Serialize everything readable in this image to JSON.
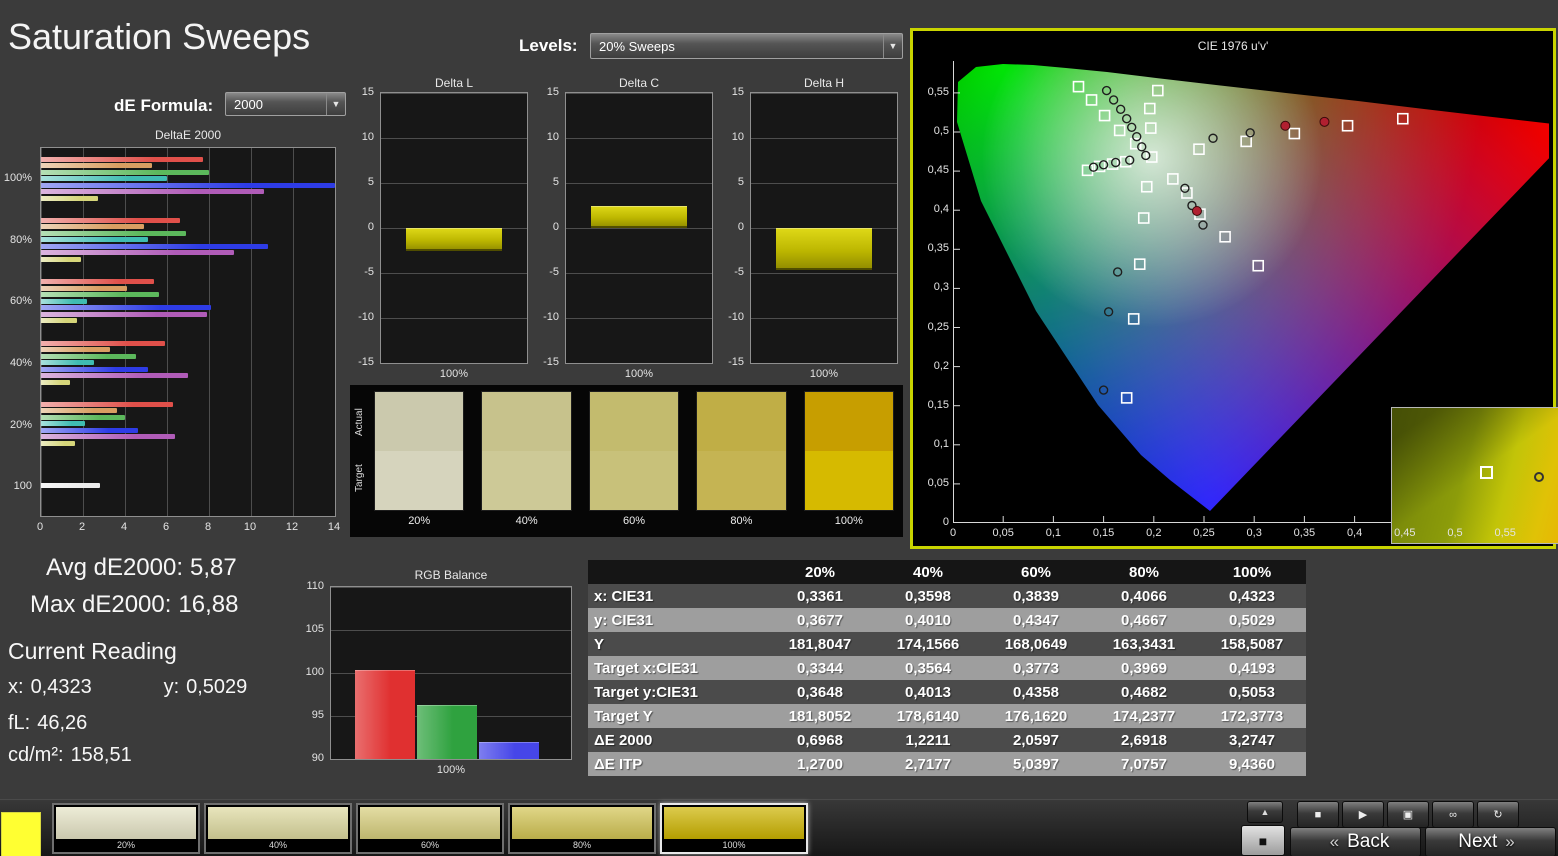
{
  "window": {
    "title": "Saturation Sweeps",
    "background": "#3b3b3b",
    "accent_border": "#c9d400"
  },
  "controls": {
    "levels": {
      "label": "Levels:",
      "value": "20% Sweeps"
    },
    "de_formula": {
      "label": "dE Formula:",
      "value": "2000"
    }
  },
  "summary": {
    "avg": {
      "label": "Avg dE2000:",
      "value": "5,87"
    },
    "max": {
      "label": "Max dE2000:",
      "value": "16,88"
    },
    "current_reading": "Current Reading",
    "x": {
      "label": "x:",
      "value": "0,4323"
    },
    "y": {
      "label": "y:",
      "value": "0,5029"
    },
    "fl": {
      "label": "fL:",
      "value": "46,26"
    },
    "cdm2": {
      "label": "cd/m²:",
      "value": "158,51"
    }
  },
  "chart_data": {
    "deltae2000": {
      "type": "bar",
      "title": "DeltaE 2000",
      "orientation": "horizontal",
      "xlim": [
        0,
        14
      ],
      "xticks": [
        0,
        2,
        4,
        6,
        8,
        10,
        12,
        14
      ],
      "groups": [
        "100%",
        "80%",
        "60%",
        "40%",
        "20%",
        "100"
      ],
      "series_colors": [
        "#e0504a",
        "#d99e62",
        "#5cb85c",
        "#3fbcb2",
        "#2e3ce6",
        "#b05cb8",
        "#d6d67a"
      ],
      "single_color": "#ececec",
      "values": [
        [
          7.7,
          5.3,
          8.0,
          6.0,
          14.3,
          10.6,
          2.7
        ],
        [
          6.6,
          4.9,
          6.9,
          5.1,
          10.8,
          9.2,
          1.9
        ],
        [
          5.4,
          4.1,
          5.6,
          2.2,
          8.1,
          7.9,
          1.7
        ],
        [
          5.9,
          3.3,
          4.5,
          2.5,
          5.1,
          7.0,
          1.4
        ],
        [
          6.3,
          3.6,
          4.0,
          2.1,
          4.6,
          6.4,
          1.6
        ],
        [
          2.8
        ]
      ]
    },
    "delta_l": {
      "type": "bar",
      "title": "Delta L",
      "ylim": [
        -15,
        15
      ],
      "yticks": [
        15,
        10,
        5,
        0,
        -5,
        -10,
        -15
      ],
      "xlabel": "100%",
      "values": [
        -2.5
      ],
      "bar_color": "#bcb600"
    },
    "delta_c": {
      "type": "bar",
      "title": "Delta C",
      "ylim": [
        -15,
        15
      ],
      "yticks": [
        15,
        10,
        5,
        0,
        -5,
        -10,
        -15
      ],
      "xlabel": "100%",
      "values": [
        2.4
      ],
      "bar_color": "#bcb600"
    },
    "delta_h": {
      "type": "bar",
      "title": "Delta H",
      "ylim": [
        -15,
        15
      ],
      "yticks": [
        15,
        10,
        5,
        0,
        -5,
        -10,
        -15
      ],
      "xlabel": "100%",
      "values": [
        -4.7
      ],
      "bar_color": "#bcb600"
    },
    "rgb_balance": {
      "type": "bar",
      "title": "RGB Balance",
      "ylim": [
        90,
        110
      ],
      "yticks": [
        110,
        105,
        100,
        95,
        90
      ],
      "xlabel": "100%",
      "series": [
        {
          "name": "Red",
          "value": 100.3,
          "color": "#e03030"
        },
        {
          "name": "Green",
          "value": 96.3,
          "color": "#2fa23f"
        },
        {
          "name": "Blue",
          "value": 92.0,
          "color": "#4646e8"
        }
      ]
    },
    "cie": {
      "type": "scatter",
      "title": "CIE 1976 u'v'",
      "xlim": [
        0,
        0.5936
      ],
      "ylim": [
        0,
        0.5908
      ],
      "xtick_labels": [
        "0",
        "0,05",
        "0,1",
        "0,15",
        "0,2",
        "0,25",
        "0,3",
        "0,35",
        "0,4",
        "0,45",
        "0,5",
        "0,55"
      ],
      "ytick_labels": [
        "0,55",
        "0,5",
        "0,45",
        "0,4",
        "0,35",
        "0,3",
        "0,25",
        "0,2",
        "0,15",
        "0,1",
        "0,05",
        "0"
      ],
      "targets": [
        [
          0.198,
          0.468
        ],
        [
          0.245,
          0.478
        ],
        [
          0.292,
          0.488
        ],
        [
          0.34,
          0.498
        ],
        [
          0.393,
          0.508
        ],
        [
          0.448,
          0.517
        ],
        [
          0.182,
          0.485
        ],
        [
          0.166,
          0.502
        ],
        [
          0.151,
          0.521
        ],
        [
          0.138,
          0.541
        ],
        [
          0.125,
          0.558
        ],
        [
          0.193,
          0.43
        ],
        [
          0.19,
          0.39
        ],
        [
          0.186,
          0.331
        ],
        [
          0.18,
          0.261
        ],
        [
          0.173,
          0.16
        ],
        [
          0.172,
          0.462
        ],
        [
          0.159,
          0.459
        ],
        [
          0.146,
          0.456
        ],
        [
          0.134,
          0.451
        ],
        [
          0.219,
          0.44
        ],
        [
          0.233,
          0.422
        ],
        [
          0.246,
          0.395
        ],
        [
          0.271,
          0.366
        ],
        [
          0.304,
          0.329
        ],
        [
          0.197,
          0.505
        ],
        [
          0.196,
          0.53
        ],
        [
          0.204,
          0.553
        ]
      ],
      "measurements": [
        [
          0.153,
          0.553
        ],
        [
          0.16,
          0.541
        ],
        [
          0.167,
          0.529
        ],
        [
          0.173,
          0.517
        ],
        [
          0.178,
          0.506
        ],
        [
          0.183,
          0.494
        ],
        [
          0.188,
          0.481
        ],
        [
          0.192,
          0.47
        ],
        [
          0.259,
          0.492
        ],
        [
          0.296,
          0.499
        ],
        [
          0.231,
          0.428
        ],
        [
          0.238,
          0.406
        ],
        [
          0.249,
          0.381
        ],
        [
          0.164,
          0.321
        ],
        [
          0.155,
          0.27
        ],
        [
          0.15,
          0.17
        ],
        [
          0.14,
          0.455
        ],
        [
          0.15,
          0.458
        ],
        [
          0.162,
          0.461
        ],
        [
          0.176,
          0.464
        ]
      ],
      "measurements_flagged": [
        [
          0.331,
          0.508
        ],
        [
          0.37,
          0.513
        ],
        [
          0.243,
          0.399
        ]
      ],
      "flag_color": "#b02030"
    },
    "table": {
      "type": "table",
      "columns": [
        "",
        "20%",
        "40%",
        "60%",
        "80%",
        "100%"
      ],
      "rows": [
        {
          "label": "x: CIE31",
          "cells": [
            "0,3361",
            "0,3598",
            "0,3839",
            "0,4066",
            "0,4323"
          ]
        },
        {
          "label": "y: CIE31",
          "cells": [
            "0,3677",
            "0,4010",
            "0,4347",
            "0,4667",
            "0,5029"
          ]
        },
        {
          "label": "Y",
          "cells": [
            "181,8047",
            "174,1566",
            "168,0649",
            "163,3431",
            "158,5087"
          ]
        },
        {
          "label": "Target x:CIE31",
          "cells": [
            "0,3344",
            "0,3564",
            "0,3773",
            "0,3969",
            "0,4193"
          ]
        },
        {
          "label": "Target y:CIE31",
          "cells": [
            "0,3648",
            "0,4013",
            "0,4358",
            "0,4682",
            "0,5053"
          ]
        },
        {
          "label": "Target Y",
          "cells": [
            "181,8052",
            "178,6140",
            "176,1620",
            "174,2377",
            "172,3773"
          ]
        },
        {
          "label": "ΔE 2000",
          "cells": [
            "0,6968",
            "1,2211",
            "2,0597",
            "2,6918",
            "3,2747"
          ]
        },
        {
          "label": "ΔE ITP",
          "cells": [
            "1,2700",
            "2,7177",
            "5,0397",
            "7,0757",
            "9,4360"
          ]
        }
      ]
    }
  },
  "strip": {
    "actual_label": "Actual",
    "target_label": "Target",
    "items": [
      {
        "label": "20%",
        "actual": "#cbc9ad",
        "target": "#d6d4bd"
      },
      {
        "label": "40%",
        "actual": "#c7c28c",
        "target": "#cdc997"
      },
      {
        "label": "60%",
        "actual": "#c3bb6e",
        "target": "#c8c17a"
      },
      {
        "label": "80%",
        "actual": "#c0ae46",
        "target": "#c5b453"
      },
      {
        "label": "100%",
        "actual": "#c79e00",
        "target": "#d6ba00"
      }
    ]
  },
  "bottom_bar": {
    "current_patch_color": "#ffff32",
    "swatches": [
      {
        "label": "20%",
        "color": "#e6e4c6",
        "selected": false
      },
      {
        "label": "40%",
        "color": "#dedaa0",
        "selected": false
      },
      {
        "label": "60%",
        "color": "#d8cf7d",
        "selected": false
      },
      {
        "label": "80%",
        "color": "#d3c554",
        "selected": false
      },
      {
        "label": "100%",
        "color": "#cdb400",
        "selected": true
      }
    ],
    "up_button_icon": "▲",
    "transport": [
      {
        "name": "stop",
        "icon": "■"
      },
      {
        "name": "play",
        "icon": "▶"
      },
      {
        "name": "pattern-window",
        "icon": "▣"
      },
      {
        "name": "continuous",
        "icon": "∞"
      },
      {
        "name": "repeat",
        "icon": "↻"
      }
    ],
    "pattern_button_icon": "■",
    "back_button": {
      "chevron": "«",
      "label": "Back"
    },
    "next_button": {
      "label": "Next",
      "chevron": "»"
    }
  }
}
